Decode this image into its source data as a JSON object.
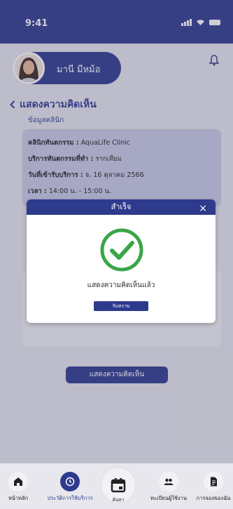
{
  "status": {
    "time": "9:41"
  },
  "user": {
    "name": "มานี มีหม้อ"
  },
  "page": {
    "title": "แสดงความคิดเห็น",
    "section_label": "ข้อมูลคลินิก"
  },
  "clinic": {
    "rows": [
      {
        "label": "คลินิกทันตกรรม :",
        "value": " AquaLife Clinic"
      },
      {
        "label": "บริการทันตกรรมที่ทำ :",
        "value": " รากเทียม"
      },
      {
        "label": "วันที่เข้ารับบริการ :",
        "value": " จ. 16 ตุลาคม 2566"
      },
      {
        "label": "เวลา :",
        "value": " 14:00 น. - 15:00 น."
      }
    ]
  },
  "submit_button": "แสดงความคิดเห็น",
  "dialog": {
    "title": "สำเร็จ",
    "close": "×",
    "message": "แสดงความคิดเห็นแล้ว",
    "ack_button": "รับทราบ"
  },
  "tabs": [
    {
      "label": "หน้าหลัก",
      "icon": "home-icon",
      "active": false
    },
    {
      "label": "ประวัติการใช้บริการ",
      "icon": "history-icon",
      "active": true
    },
    {
      "label": "ค้นหา",
      "icon": "calendar-icon",
      "active": false
    },
    {
      "label": "ทะเบียนผู้ใช้งาน",
      "icon": "users-icon",
      "active": false
    },
    {
      "label": "การจองของฉัน",
      "icon": "document-icon",
      "active": false
    }
  ],
  "colors": {
    "primary": "#2e3a8c",
    "card": "#c9cbe3",
    "success": "#3aa548"
  }
}
